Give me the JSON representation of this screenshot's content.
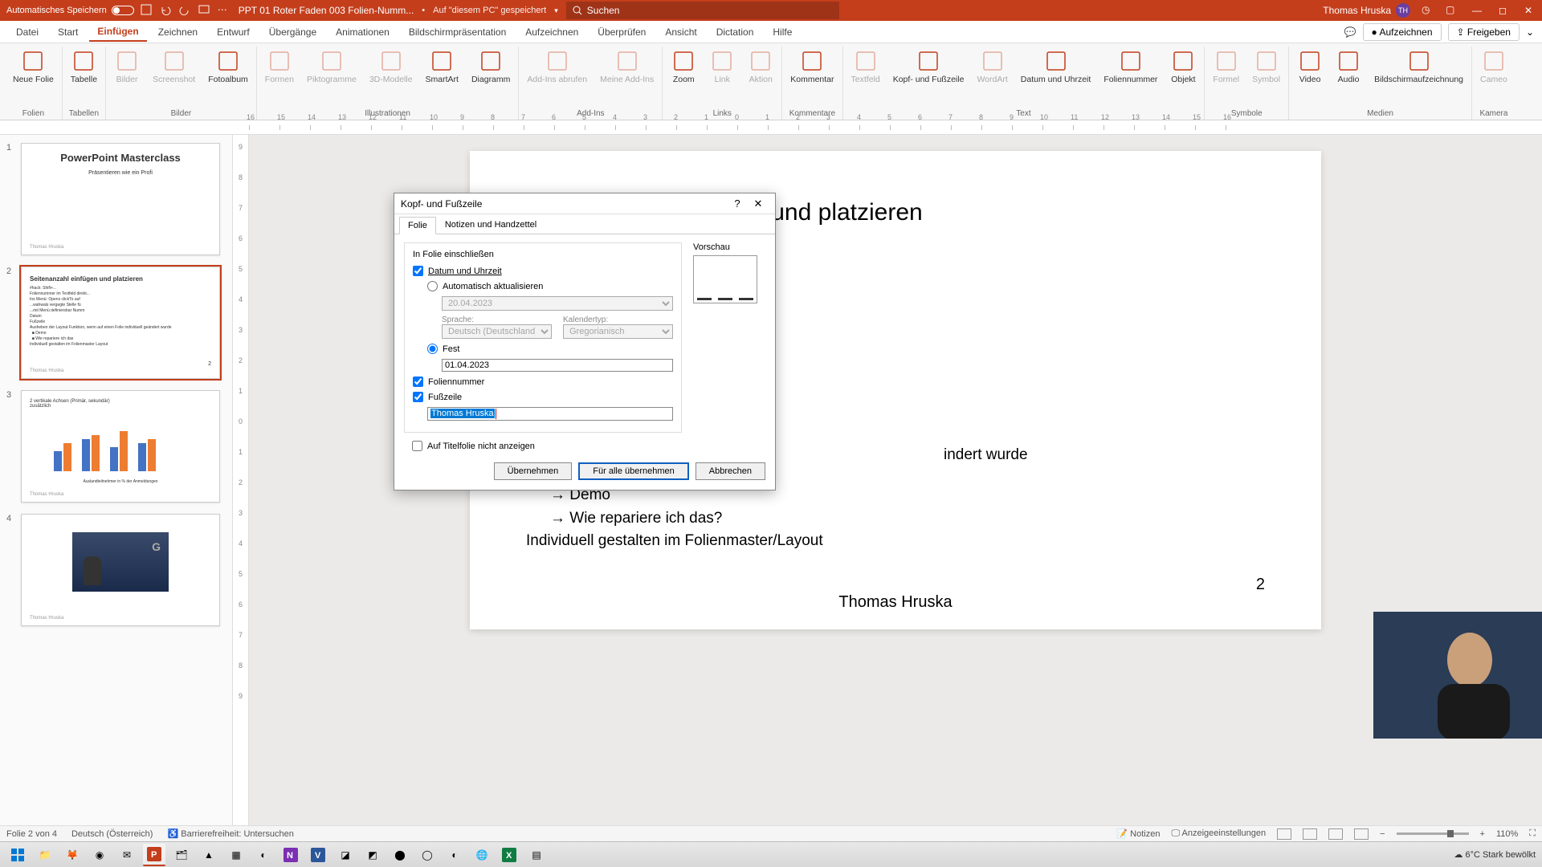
{
  "titlebar": {
    "autosave": "Automatisches Speichern",
    "doc": "PPT 01 Roter Faden 003 Folien-Numm...",
    "saved": "Auf \"diesem PC\" gespeichert",
    "search_placeholder": "Suchen",
    "user": "Thomas Hruska",
    "user_initials": "TH"
  },
  "tabs": [
    "Datei",
    "Start",
    "Einfügen",
    "Zeichnen",
    "Entwurf",
    "Übergänge",
    "Animationen",
    "Bildschirmpräsentation",
    "Aufzeichnen",
    "Überprüfen",
    "Ansicht",
    "Dictation",
    "Hilfe"
  ],
  "tab_active": 2,
  "tab_right": {
    "record": "Aufzeichnen",
    "share": "Freigeben"
  },
  "ribbon": {
    "groups": [
      {
        "label": "Folien",
        "items": [
          {
            "l": "Neue Folie"
          }
        ]
      },
      {
        "label": "Tabellen",
        "items": [
          {
            "l": "Tabelle"
          }
        ]
      },
      {
        "label": "Bilder",
        "items": [
          {
            "l": "Bilder",
            "d": true
          },
          {
            "l": "Screenshot",
            "d": true
          },
          {
            "l": "Fotoalbum"
          }
        ]
      },
      {
        "label": "Illustrationen",
        "items": [
          {
            "l": "Formen",
            "d": true
          },
          {
            "l": "Piktogramme",
            "d": true
          },
          {
            "l": "3D-Modelle",
            "d": true
          },
          {
            "l": "SmartArt"
          },
          {
            "l": "Diagramm"
          }
        ]
      },
      {
        "label": "Add-Ins",
        "items": [
          {
            "l": "Add-Ins abrufen",
            "d": true
          },
          {
            "l": "Meine Add-Ins",
            "d": true
          }
        ]
      },
      {
        "label": "Links",
        "items": [
          {
            "l": "Zoom"
          },
          {
            "l": "Link",
            "d": true
          },
          {
            "l": "Aktion",
            "d": true
          }
        ]
      },
      {
        "label": "Kommentare",
        "items": [
          {
            "l": "Kommentar"
          }
        ]
      },
      {
        "label": "Text",
        "items": [
          {
            "l": "Textfeld",
            "d": true
          },
          {
            "l": "Kopf- und Fußzeile"
          },
          {
            "l": "WordArt",
            "d": true
          },
          {
            "l": "Datum und Uhrzeit"
          },
          {
            "l": "Foliennummer"
          },
          {
            "l": "Objekt"
          }
        ]
      },
      {
        "label": "Symbole",
        "items": [
          {
            "l": "Formel",
            "d": true
          },
          {
            "l": "Symbol",
            "d": true
          }
        ]
      },
      {
        "label": "Medien",
        "items": [
          {
            "l": "Video"
          },
          {
            "l": "Audio"
          },
          {
            "l": "Bildschirmaufzeichnung"
          }
        ]
      },
      {
        "label": "Kamera",
        "items": [
          {
            "l": "Cameo",
            "d": true
          }
        ]
      }
    ]
  },
  "ruler_marks": [
    "16",
    "15",
    "14",
    "13",
    "12",
    "11",
    "10",
    "9",
    "8",
    "7",
    "6",
    "5",
    "4",
    "3",
    "2",
    "1",
    "0",
    "1",
    "2",
    "3",
    "4",
    "5",
    "6",
    "7",
    "8",
    "9",
    "10",
    "11",
    "12",
    "13",
    "14",
    "15",
    "16"
  ],
  "ruler_v": [
    "9",
    "8",
    "7",
    "6",
    "5",
    "4",
    "3",
    "2",
    "1",
    "0",
    "1",
    "2",
    "3",
    "4",
    "5",
    "6",
    "7",
    "8",
    "9"
  ],
  "thumbs": [
    {
      "n": "1",
      "title": "PowerPoint Masterclass",
      "sub": "Präsentieren wie ein Profi",
      "footer": "Thomas Hruska"
    },
    {
      "n": "2",
      "title": "Seitenanzahl einfügen und platzieren",
      "footer": "Thomas Hruska",
      "selected": true,
      "pagenum": "2"
    },
    {
      "n": "3",
      "title": "",
      "footer": "Thomas Hruska"
    },
    {
      "n": "4",
      "title": "",
      "footer": "Thomas Hruska"
    }
  ],
  "slide": {
    "title": "Seitenanzahl einfügen und platzieren",
    "lines": [
      "#hack: S",
      "",
      "Folien vo",
      "Foliennu",
      "Ins Menü",
      "Für alle ü",
      "",
      "Datum",
      "Fußzeile",
      "Aushebe",
      "→ Demo",
      "→ Wie repariere ich das?",
      "Individuell gestalten im Folienmaster/Layout"
    ],
    "behind_right": "indert wurde",
    "pagenum": "2",
    "footer": "Thomas Hruska"
  },
  "dialog": {
    "title": "Kopf- und Fußzeile",
    "tabs": [
      "Folie",
      "Notizen und Handzettel"
    ],
    "tab_active": 0,
    "section": "In Folie einschließen",
    "date_label": "Datum und Uhrzeit",
    "auto_label": "Automatisch aktualisieren",
    "auto_value": "20.04.2023",
    "lang_label": "Sprache:",
    "lang_value": "Deutsch (Deutschland)",
    "cal_label": "Kalendertyp:",
    "cal_value": "Gregorianisch",
    "fixed_label": "Fest",
    "fixed_value": "01.04.2023",
    "slidenum_label": "Foliennummer",
    "footer_label": "Fußzeile",
    "footer_value": "Thomas Hruska",
    "notitle_label": "Auf Titelfolie nicht anzeigen",
    "preview_label": "Vorschau",
    "btn_apply": "Übernehmen",
    "btn_applyall": "Für alle übernehmen",
    "btn_cancel": "Abbrechen"
  },
  "status": {
    "slide": "Folie 2 von 4",
    "lang": "Deutsch (Österreich)",
    "access": "Barrierefreiheit: Untersuchen",
    "notes": "Notizen",
    "display": "Anzeigeeinstellungen",
    "zoom": "110%"
  },
  "taskbar": {
    "weather": "6°C  Stark bewölkt"
  }
}
